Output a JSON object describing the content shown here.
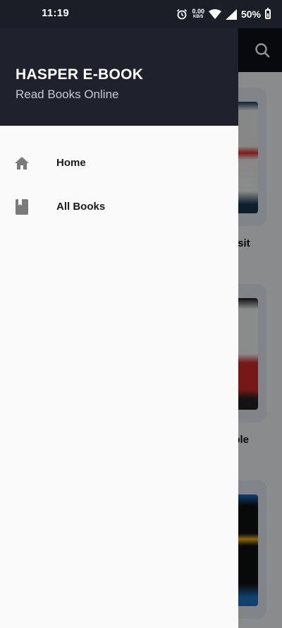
{
  "status_bar": {
    "time": "11:19",
    "net_speed_value": "0.00",
    "net_speed_unit": "KB/S",
    "battery": "50%",
    "icons": [
      "alarm-icon",
      "wifi-icon",
      "signal-icon",
      "battery-icon"
    ]
  },
  "drawer": {
    "title": "HASPER E-BOOK",
    "subtitle": "Read Books Online",
    "items": [
      {
        "label": "Home",
        "icon": "home-icon"
      },
      {
        "label": "All Books",
        "icon": "book-icon"
      }
    ]
  },
  "background_app": {
    "book_titles_visible": [
      "or sit",
      "mple"
    ]
  },
  "colors": {
    "status_bar": "#1b1e26",
    "drawer_header": "#1f222d",
    "drawer_body": "#fafafa",
    "icon_gray": "#7a7a7a"
  }
}
